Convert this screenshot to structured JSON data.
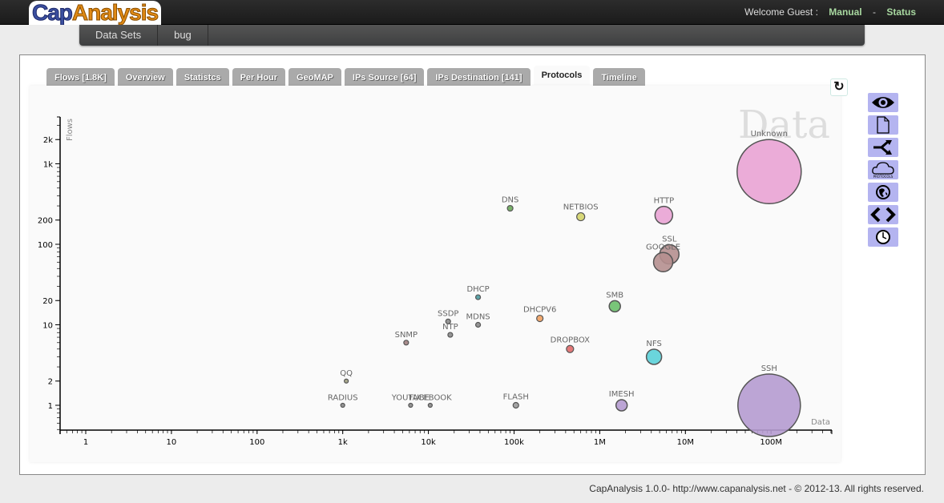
{
  "header": {
    "logo_part1": "Cap",
    "logo_part2": "Analysis",
    "welcome": "Welcome Guest :",
    "manual_link": "Manual",
    "separator": "-",
    "status_link": "Status"
  },
  "nav": {
    "items": [
      {
        "label": "Data Sets"
      },
      {
        "label": "bug"
      }
    ]
  },
  "tabs": [
    {
      "label": "Flows [1.8K]",
      "active": false
    },
    {
      "label": "Overview",
      "active": false
    },
    {
      "label": "Statistcs",
      "active": false
    },
    {
      "label": "Per Hour",
      "active": false
    },
    {
      "label": "GeoMAP",
      "active": false
    },
    {
      "label": "IPs Source [64]",
      "active": false
    },
    {
      "label": "IPs Destination [141]",
      "active": false
    },
    {
      "label": "Protocols",
      "active": true
    },
    {
      "label": "Timeline",
      "active": false
    }
  ],
  "refresh": {
    "icon": "refresh-icon"
  },
  "side_tools": [
    {
      "name": "eye-icon"
    },
    {
      "name": "document-icon"
    },
    {
      "name": "merge-arrows-icon"
    },
    {
      "name": "cloud-protocols-icon"
    },
    {
      "name": "globe-icon"
    },
    {
      "name": "code-brackets-icon"
    },
    {
      "name": "clock-icon"
    }
  ],
  "footer": {
    "text": "CapAnalysis 1.0.0- http://www.capanalysis.net - © 2012-13. All rights reserved."
  },
  "chart_data": {
    "type": "scatter",
    "subtype": "bubble",
    "title": "",
    "watermark": "Data",
    "xlabel": "Data",
    "ylabel": "Flows",
    "xscale": "log",
    "yscale": "log",
    "xlim": [
      0.5,
      500000000
    ],
    "ylim": [
      0.5,
      3000
    ],
    "x_ticks": [
      {
        "value": 1,
        "label": "1"
      },
      {
        "value": 10,
        "label": "10"
      },
      {
        "value": 100,
        "label": "100"
      },
      {
        "value": 1000,
        "label": "1k"
      },
      {
        "value": 10000,
        "label": "10k"
      },
      {
        "value": 100000,
        "label": "100k"
      },
      {
        "value": 1000000,
        "label": "1M"
      },
      {
        "value": 10000000,
        "label": "10M"
      },
      {
        "value": 100000000,
        "label": "100M"
      }
    ],
    "y_ticks": [
      {
        "value": 1,
        "label": "1"
      },
      {
        "value": 2,
        "label": "2"
      },
      {
        "value": 10,
        "label": "10"
      },
      {
        "value": 20,
        "label": "20"
      },
      {
        "value": 100,
        "label": "100"
      },
      {
        "value": 200,
        "label": "200"
      },
      {
        "value": 1000,
        "label": "1k"
      },
      {
        "value": 2000,
        "label": "2k"
      }
    ],
    "grid": false,
    "points": [
      {
        "name": "Unknown",
        "x": 95000000,
        "y": 800,
        "size": 40,
        "color": "#e9a3d4"
      },
      {
        "name": "SSH",
        "x": 95000000,
        "y": 1,
        "size": 39,
        "color": "#b59bd0"
      },
      {
        "name": "HTTP",
        "x": 5600000,
        "y": 230,
        "size": 11,
        "color": "#e9a3d4"
      },
      {
        "name": "SSL",
        "x": 6500000,
        "y": 75,
        "size": 12,
        "color": "#b58f8f"
      },
      {
        "name": "GOOGLE",
        "x": 5500000,
        "y": 60,
        "size": 12,
        "color": "#b58f8f"
      },
      {
        "name": "DNS",
        "x": 90000,
        "y": 280,
        "size": 3.5,
        "color": "#6aa85a"
      },
      {
        "name": "NETBIOS",
        "x": 600000,
        "y": 220,
        "size": 5,
        "color": "#d4d46a"
      },
      {
        "name": "SMB",
        "x": 1500000,
        "y": 17,
        "size": 7,
        "color": "#6abf6a"
      },
      {
        "name": "NFS",
        "x": 4300000,
        "y": 4,
        "size": 9.5,
        "color": "#5ad0d8"
      },
      {
        "name": "IMESH",
        "x": 1800000,
        "y": 1,
        "size": 7,
        "color": "#b59bd0"
      },
      {
        "name": "DROPBOX",
        "x": 450000,
        "y": 5,
        "size": 4.5,
        "color": "#e06a6a"
      },
      {
        "name": "DHCPV6",
        "x": 200000,
        "y": 12,
        "size": 4,
        "color": "#f0a060"
      },
      {
        "name": "FLASH",
        "x": 105000,
        "y": 1,
        "size": 3.5,
        "color": "#9a9a9a"
      },
      {
        "name": "DHCP",
        "x": 38000,
        "y": 22,
        "size": 3,
        "color": "#4a9aa0"
      },
      {
        "name": "MDNS",
        "x": 38000,
        "y": 10,
        "size": 3,
        "color": "#8a8a8a"
      },
      {
        "name": "SSDP",
        "x": 17000,
        "y": 11,
        "size": 3,
        "color": "#8a8a8a"
      },
      {
        "name": "NTP",
        "x": 18000,
        "y": 7.5,
        "size": 3,
        "color": "#8a8a8a"
      },
      {
        "name": "SNMP",
        "x": 5500,
        "y": 6,
        "size": 3,
        "color": "#a08080"
      },
      {
        "name": "QQ",
        "x": 1100,
        "y": 2,
        "size": 2.5,
        "color": "#a0a080"
      },
      {
        "name": "RADIUS",
        "x": 1000,
        "y": 1,
        "size": 2.5,
        "color": "#8a8a8a"
      },
      {
        "name": "YOUTUBE",
        "x": 6200,
        "y": 1,
        "size": 2.5,
        "color": "#8a8a8a"
      },
      {
        "name": "FACEBOOK",
        "x": 10500,
        "y": 1,
        "size": 2.5,
        "color": "#8a8a8a"
      }
    ]
  }
}
